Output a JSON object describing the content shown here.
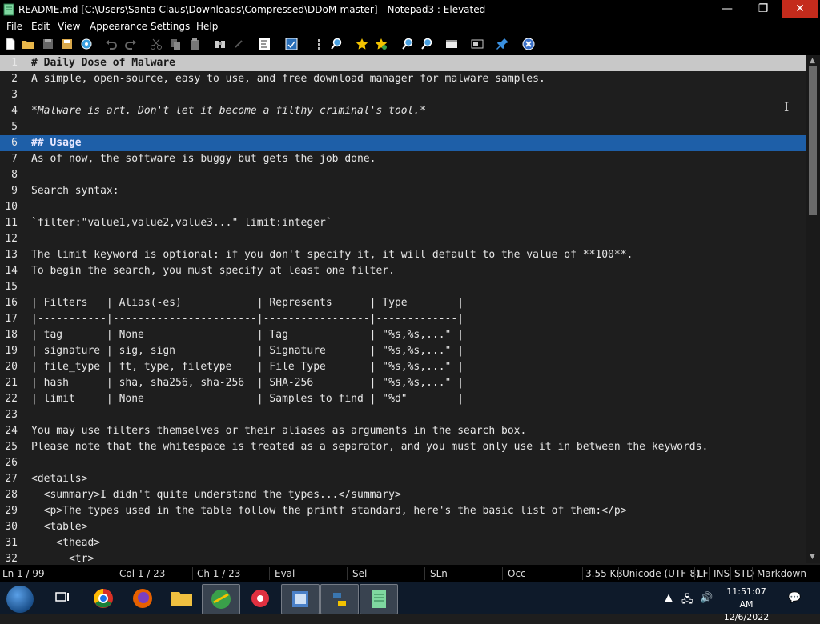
{
  "window": {
    "title": "README.md [C:\\Users\\Santa Claus\\Downloads\\Compressed\\DDoM-master] - Notepad3 : Elevated",
    "minimize": "—",
    "maximize": "❐",
    "close": "✕"
  },
  "menu": [
    "File",
    "Edit",
    "View",
    "Appearance",
    "Settings",
    "Help"
  ],
  "toolbar_icons": [
    "new-file-icon",
    "open-folder-icon",
    "save-icon",
    "save-as-icon",
    "browse-icon",
    "undo-icon",
    "redo-icon",
    "cut-icon",
    "copy-icon",
    "paste-icon",
    "find-icon",
    "replace-icon",
    "word-wrap-icon",
    "show-whitespace-icon",
    "toggle-fold-icon",
    "find-in-files-icon",
    "add-bookmark-icon",
    "goto-bookmark-icon",
    "zoom-in-icon",
    "zoom-out-icon",
    "scheme-icon",
    "customize-icon",
    "pin-icon",
    "exit-icon"
  ],
  "editor": {
    "lines": [
      {
        "n": "1",
        "t": "# Daily Dose of Malware"
      },
      {
        "n": "2",
        "t": "A simple, open-source, easy to use, and free download manager for malware samples."
      },
      {
        "n": "3",
        "t": ""
      },
      {
        "n": "4",
        "t": "*Malware is art. Don't let it become a filthy criminal's tool.*"
      },
      {
        "n": "5",
        "t": ""
      },
      {
        "n": "6",
        "t": "## Usage"
      },
      {
        "n": "7",
        "t": "As of now, the software is buggy but gets the job done."
      },
      {
        "n": "8",
        "t": ""
      },
      {
        "n": "9",
        "t": "Search syntax:"
      },
      {
        "n": "10",
        "t": ""
      },
      {
        "n": "11",
        "t": "`filter:\"value1,value2,value3...\" limit:integer`"
      },
      {
        "n": "12",
        "t": ""
      },
      {
        "n": "13",
        "t": "The limit keyword is optional: if you don't specify it, it will default to the value of **100**."
      },
      {
        "n": "14",
        "t": "To begin the search, you must specify at least one filter."
      },
      {
        "n": "15",
        "t": ""
      },
      {
        "n": "16",
        "t": "| Filters   | Alias(-es)            | Represents      | Type        |"
      },
      {
        "n": "17",
        "t": "|-----------|-----------------------|-----------------|-------------|"
      },
      {
        "n": "18",
        "t": "| tag       | None                  | Tag             | \"%s,%s,...\" |"
      },
      {
        "n": "19",
        "t": "| signature | sig, sign             | Signature       | \"%s,%s,...\" |"
      },
      {
        "n": "20",
        "t": "| file_type | ft, type, filetype    | File Type       | \"%s,%s,...\" |"
      },
      {
        "n": "21",
        "t": "| hash      | sha, sha256, sha-256  | SHA-256         | \"%s,%s,...\" |"
      },
      {
        "n": "22",
        "t": "| limit     | None                  | Samples to find | \"%d\"        |"
      },
      {
        "n": "23",
        "t": ""
      },
      {
        "n": "24",
        "t": "You may use filters themselves or their aliases as arguments in the search box."
      },
      {
        "n": "25",
        "t": "Please note that the whitespace is treated as a separator, and you must only use it in between the keywords."
      },
      {
        "n": "26",
        "t": ""
      },
      {
        "n": "27",
        "t": "<details>"
      },
      {
        "n": "28",
        "t": "  <summary>I didn't quite understand the types...</summary>"
      },
      {
        "n": "29",
        "t": "  <p>The types used in the table follow the printf standard, here's the basic list of them:</p>"
      },
      {
        "n": "30",
        "t": "  <table>"
      },
      {
        "n": "31",
        "t": "    <thead>"
      },
      {
        "n": "32",
        "t": "      <tr>"
      }
    ]
  },
  "status": {
    "ln": "Ln 1 / 99",
    "col": "Col 1 / 23",
    "ch": "Ch 1 / 23",
    "eval": "Eval --",
    "sel": "Sel --",
    "sln": "SLn --",
    "occ": "Occ --",
    "size": "3.55 KB",
    "encoding": "Unicode (UTF-8)",
    "eol": "LF",
    "ins": "INS",
    "std": "STD",
    "lexer": "Markdown"
  },
  "taskbar": {
    "time": "11:51:07 AM",
    "date": "12/6/2022"
  }
}
